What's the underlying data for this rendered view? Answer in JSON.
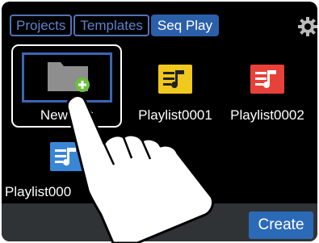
{
  "tabs": [
    {
      "label": "Projects",
      "active": false
    },
    {
      "label": "Templates",
      "active": false
    },
    {
      "label": "Seq Play",
      "active": true
    }
  ],
  "items": [
    {
      "label": "New List",
      "icon": "new-folder-icon",
      "selected": true
    },
    {
      "label": "Playlist0001",
      "icon": "playlist-icon",
      "color": "#f0c81e"
    },
    {
      "label": "Playlist0002",
      "icon": "playlist-icon",
      "color": "#e8413a"
    },
    {
      "label": "Playlist000",
      "icon": "playlist-icon",
      "color": "#3a86d6"
    }
  ],
  "create_label": "Create",
  "colors": {
    "accent": "#2b5faa",
    "bottom_bar": "#2f3336"
  }
}
